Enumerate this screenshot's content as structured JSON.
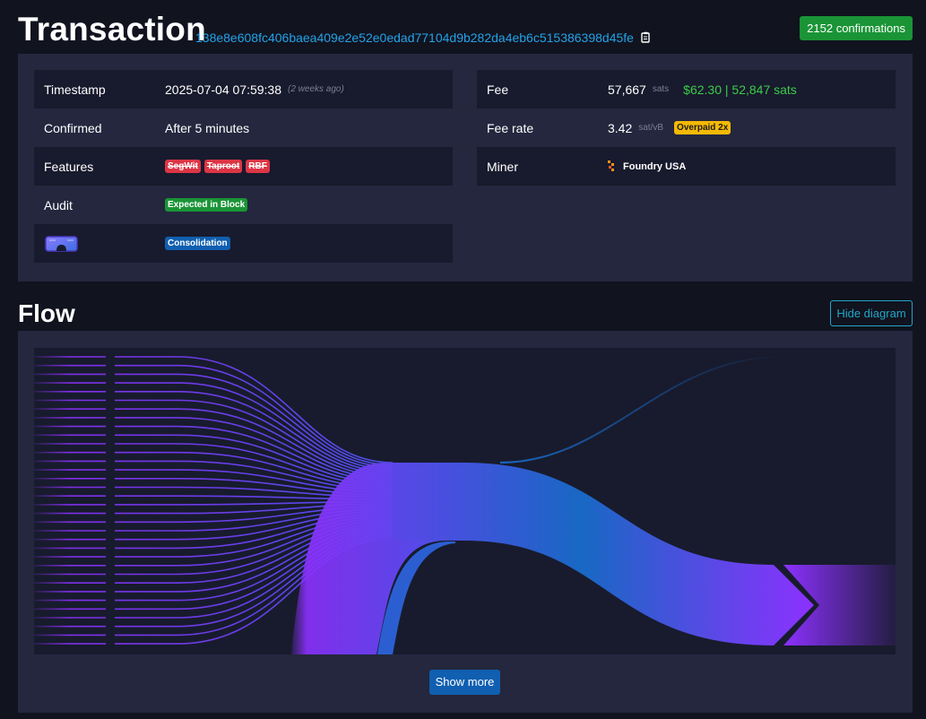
{
  "header": {
    "title": "Transaction",
    "txid": "138e8e608fc406baea409e2e52e0edad77104d9b282da4eb6c515386398d45fe",
    "confirmations": "2152 confirmations"
  },
  "details_left": [
    {
      "label": "Timestamp",
      "value": "2025-07-04 07:59:38",
      "note": "(2 weeks ago)"
    },
    {
      "label": "Confirmed",
      "value": "After 5 minutes"
    },
    {
      "label": "Features",
      "badges": [
        "SegWit",
        "Taproot",
        "RBF"
      ]
    },
    {
      "label": "Audit",
      "badge": "Expected in Block"
    },
    {
      "icon": "goggles-icon",
      "badge": "Consolidation"
    }
  ],
  "details_right": [
    {
      "label": "Fee",
      "value": "57,667",
      "unit": "sats",
      "fiat": "$62.30 | 52,847 sats"
    },
    {
      "label": "Fee rate",
      "value": "3.42",
      "unit": "sat/vB",
      "badge": "Overpaid 2x"
    },
    {
      "label": "Miner",
      "value": "Foundry USA",
      "icon": "foundry-logo-icon"
    }
  ],
  "flow": {
    "title": "Flow",
    "hide_label": "Hide diagram",
    "show_more_label": "Show more",
    "input_count_shown": 34
  },
  "colors": {
    "background": "#11131f",
    "panel": "#24273e",
    "row_alt": "#181a2d",
    "link": "#22a3e8",
    "green": "#1a9436",
    "red": "#dc3545",
    "blue": "#105fb0",
    "yellow": "#f5b903",
    "flow_purple": "#8c31ff",
    "flow_blue": "#1068c1"
  }
}
